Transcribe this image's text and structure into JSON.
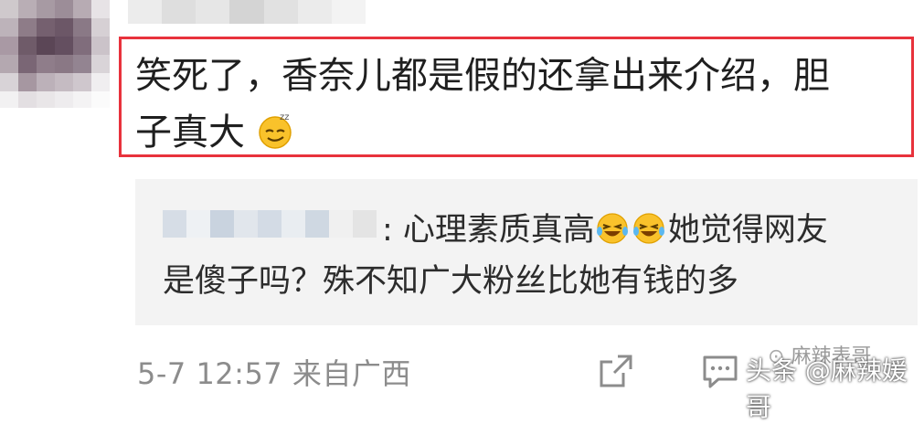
{
  "comment": {
    "text_line1": "笑死了，香奈儿都是假的还拿出来介绍，胆",
    "text_line2": "子真大",
    "emoji_icon": "dizzy-smile-emoji",
    "highlight_color": "#e8323c"
  },
  "reply": {
    "text_line1": ": 心理素质真高",
    "text_line1_tail": "她觉得网友",
    "text_line2": "是傻子吗？殊不知广大粉丝比她有钱的多",
    "emoji_icon": "laughing-tears-emoji"
  },
  "footer": {
    "timestamp": "5-7 12:57 来自广西",
    "share_icon": "share-icon",
    "comment_icon": "comment-icon"
  },
  "watermark": {
    "text": "头条 @麻辣媛哥",
    "logo_text": "麻辣表哥"
  }
}
